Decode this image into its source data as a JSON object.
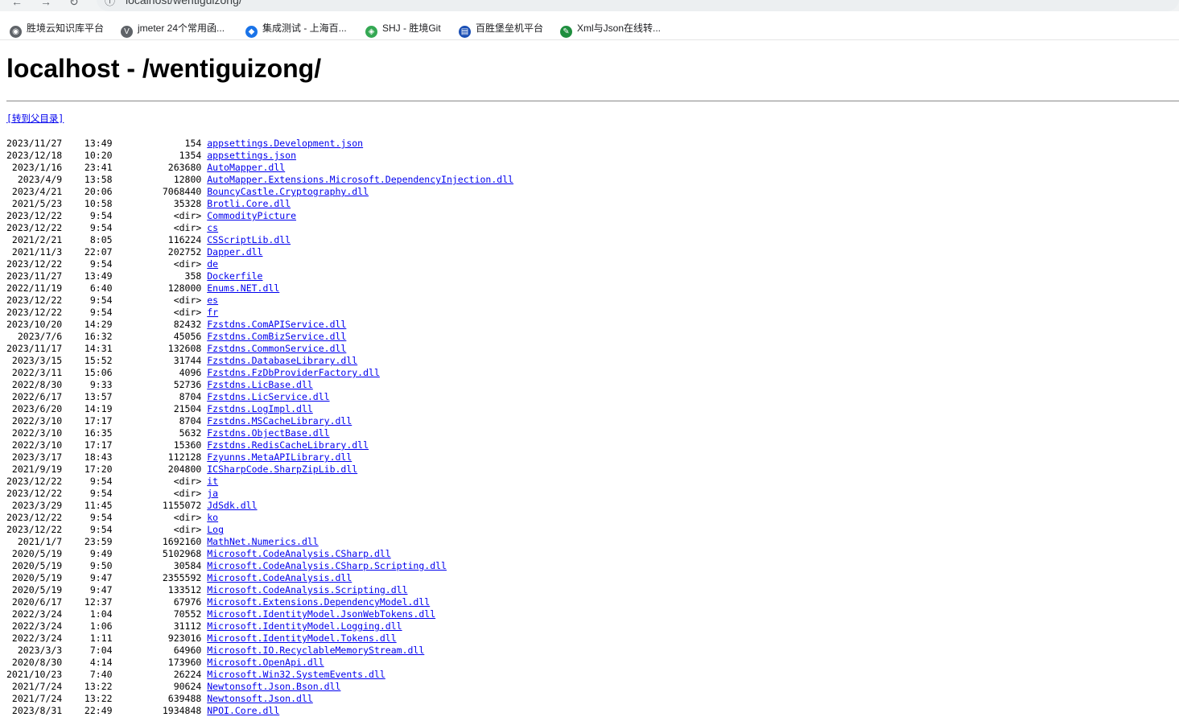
{
  "browser": {
    "url": "localhost/wentiguizong/"
  },
  "bookmarks": [
    {
      "label": "胜境云知识库平台",
      "icon": "globe-icon",
      "color": "#5f6368"
    },
    {
      "label": "jmeter 24个常用函...",
      "icon": "vector-icon",
      "color": "#5f6368"
    },
    {
      "label": "集成测试 - 上海百...",
      "icon": "diamond-icon",
      "color": "#1a73e8"
    },
    {
      "label": "SHJ - 胜境Git",
      "icon": "git-icon",
      "color": "#34a853"
    },
    {
      "label": "百胜堡垒机平台",
      "icon": "bastion-icon",
      "color": "#1a4fb5"
    },
    {
      "label": "Xml与Json在线转...",
      "icon": "wrench-icon",
      "color": "#1e8e3e"
    }
  ],
  "page": {
    "title": "localhost - /wentiguizong/",
    "parent_link": "[转到父目录]"
  },
  "entries": [
    {
      "date": "2023/11/27",
      "time": "13:49",
      "size": "154",
      "name": "appsettings.Development.json"
    },
    {
      "date": "2023/12/18",
      "time": "10:20",
      "size": "1354",
      "name": "appsettings.json"
    },
    {
      "date": "2023/1/16",
      "time": "23:41",
      "size": "263680",
      "name": "AutoMapper.dll"
    },
    {
      "date": "2023/4/9",
      "time": "13:58",
      "size": "12800",
      "name": "AutoMapper.Extensions.Microsoft.DependencyInjection.dll"
    },
    {
      "date": "2023/4/21",
      "time": "20:06",
      "size": "7068440",
      "name": "BouncyCastle.Cryptography.dll"
    },
    {
      "date": "2021/5/23",
      "time": "10:58",
      "size": "35328",
      "name": "Brotli.Core.dll"
    },
    {
      "date": "2023/12/22",
      "time": "9:54",
      "size": "<dir>",
      "name": "CommodityPicture"
    },
    {
      "date": "2023/12/22",
      "time": "9:54",
      "size": "<dir>",
      "name": "cs"
    },
    {
      "date": "2021/2/21",
      "time": "8:05",
      "size": "116224",
      "name": "CSScriptLib.dll"
    },
    {
      "date": "2021/11/3",
      "time": "22:07",
      "size": "202752",
      "name": "Dapper.dll"
    },
    {
      "date": "2023/12/22",
      "time": "9:54",
      "size": "<dir>",
      "name": "de"
    },
    {
      "date": "2023/11/27",
      "time": "13:49",
      "size": "358",
      "name": "Dockerfile"
    },
    {
      "date": "2022/11/19",
      "time": "6:40",
      "size": "128000",
      "name": "Enums.NET.dll"
    },
    {
      "date": "2023/12/22",
      "time": "9:54",
      "size": "<dir>",
      "name": "es"
    },
    {
      "date": "2023/12/22",
      "time": "9:54",
      "size": "<dir>",
      "name": "fr"
    },
    {
      "date": "2023/10/20",
      "time": "14:29",
      "size": "82432",
      "name": "Fzstdns.ComAPIService.dll"
    },
    {
      "date": "2023/7/6",
      "time": "16:32",
      "size": "45056",
      "name": "Fzstdns.ComBizService.dll"
    },
    {
      "date": "2023/11/17",
      "time": "14:31",
      "size": "132608",
      "name": "Fzstdns.CommonService.dll"
    },
    {
      "date": "2023/3/15",
      "time": "15:52",
      "size": "31744",
      "name": "Fzstdns.DatabaseLibrary.dll"
    },
    {
      "date": "2022/3/11",
      "time": "15:06",
      "size": "4096",
      "name": "Fzstdns.FzDbProviderFactory.dll"
    },
    {
      "date": "2022/8/30",
      "time": "9:33",
      "size": "52736",
      "name": "Fzstdns.LicBase.dll"
    },
    {
      "date": "2022/6/17",
      "time": "13:57",
      "size": "8704",
      "name": "Fzstdns.LicService.dll"
    },
    {
      "date": "2023/6/20",
      "time": "14:19",
      "size": "21504",
      "name": "Fzstdns.LogImpl.dll"
    },
    {
      "date": "2022/3/10",
      "time": "17:17",
      "size": "8704",
      "name": "Fzstdns.MSCacheLibrary.dll"
    },
    {
      "date": "2022/3/10",
      "time": "16:35",
      "size": "5632",
      "name": "Fzstdns.ObjectBase.dll"
    },
    {
      "date": "2022/3/10",
      "time": "17:17",
      "size": "15360",
      "name": "Fzstdns.RedisCacheLibrary.dll"
    },
    {
      "date": "2023/3/17",
      "time": "18:43",
      "size": "112128",
      "name": "Fzyunns.MetaAPILibrary.dll"
    },
    {
      "date": "2021/9/19",
      "time": "17:20",
      "size": "204800",
      "name": "ICSharpCode.SharpZipLib.dll"
    },
    {
      "date": "2023/12/22",
      "time": "9:54",
      "size": "<dir>",
      "name": "it"
    },
    {
      "date": "2023/12/22",
      "time": "9:54",
      "size": "<dir>",
      "name": "ja"
    },
    {
      "date": "2023/3/29",
      "time": "11:45",
      "size": "1155072",
      "name": "JdSdk.dll"
    },
    {
      "date": "2023/12/22",
      "time": "9:54",
      "size": "<dir>",
      "name": "ko"
    },
    {
      "date": "2023/12/22",
      "time": "9:54",
      "size": "<dir>",
      "name": "Log"
    },
    {
      "date": "2021/1/7",
      "time": "23:59",
      "size": "1692160",
      "name": "MathNet.Numerics.dll"
    },
    {
      "date": "2020/5/19",
      "time": "9:49",
      "size": "5102968",
      "name": "Microsoft.CodeAnalysis.CSharp.dll"
    },
    {
      "date": "2020/5/19",
      "time": "9:50",
      "size": "30584",
      "name": "Microsoft.CodeAnalysis.CSharp.Scripting.dll"
    },
    {
      "date": "2020/5/19",
      "time": "9:47",
      "size": "2355592",
      "name": "Microsoft.CodeAnalysis.dll"
    },
    {
      "date": "2020/5/19",
      "time": "9:47",
      "size": "133512",
      "name": "Microsoft.CodeAnalysis.Scripting.dll"
    },
    {
      "date": "2020/6/17",
      "time": "12:37",
      "size": "67976",
      "name": "Microsoft.Extensions.DependencyModel.dll"
    },
    {
      "date": "2022/3/24",
      "time": "1:04",
      "size": "70552",
      "name": "Microsoft.IdentityModel.JsonWebTokens.dll"
    },
    {
      "date": "2022/3/24",
      "time": "1:06",
      "size": "31112",
      "name": "Microsoft.IdentityModel.Logging.dll"
    },
    {
      "date": "2022/3/24",
      "time": "1:11",
      "size": "923016",
      "name": "Microsoft.IdentityModel.Tokens.dll"
    },
    {
      "date": "2023/3/3",
      "time": "7:04",
      "size": "64960",
      "name": "Microsoft.IO.RecyclableMemoryStream.dll"
    },
    {
      "date": "2020/8/30",
      "time": "4:14",
      "size": "173960",
      "name": "Microsoft.OpenApi.dll"
    },
    {
      "date": "2021/10/23",
      "time": "7:40",
      "size": "26224",
      "name": "Microsoft.Win32.SystemEvents.dll"
    },
    {
      "date": "2021/7/24",
      "time": "13:22",
      "size": "90624",
      "name": "Newtonsoft.Json.Bson.dll"
    },
    {
      "date": "2021/7/24",
      "time": "13:22",
      "size": "639488",
      "name": "Newtonsoft.Json.dll"
    },
    {
      "date": "2023/8/31",
      "time": "22:49",
      "size": "1934848",
      "name": "NPOI.Core.dll"
    }
  ]
}
